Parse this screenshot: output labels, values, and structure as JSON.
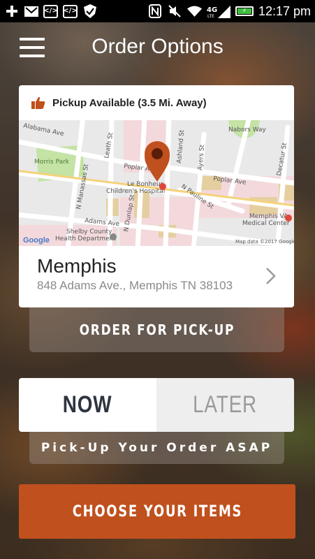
{
  "status_bar": {
    "icons": [
      "plus-icon",
      "gmail-icon",
      "code-icon",
      "code-icon",
      "check-shield-icon",
      "nfc-icon",
      "mute-icon",
      "wifi-icon",
      "lte-signal-icon",
      "battery-charging-icon"
    ],
    "network": "4G LTE",
    "time": "12:17 pm"
  },
  "header": {
    "title": "Order Options"
  },
  "location_card": {
    "pickup_label": "Pickup Available (3.5 Mi. Away)",
    "map": {
      "labels": {
        "alabama": "Alabama Ave",
        "morris_park": "Morris Park",
        "leath": "Leath St",
        "nabors": "Nabors Way",
        "ashland": "Ashland St",
        "ayers": "Ayers St",
        "decatur": "Decatur St",
        "poplar_left": "Poplar Ave",
        "poplar_right": "Poplar Ave",
        "le_bonheur_1": "Le Bonheur",
        "le_bonheur_2": "Children's Hospital",
        "manassas": "N Manassas St",
        "pauline": "N Pauline St",
        "dunlap": "N Dunlap St",
        "adams": "Adams Ave",
        "va_1": "Memphis VA",
        "va_2": "Medical Center",
        "shelby_1": "Shelby County",
        "shelby_2": "Health Department",
        "google": "Google",
        "map_data": "Map data ©2017 Google"
      }
    },
    "name": "Memphis",
    "address": "848 Adams Ave., Memphis TN 38103"
  },
  "order_type_label": "ORDER FOR PICK-UP",
  "timing": {
    "now_label": "NOW",
    "later_label": "LATER",
    "selected": "NOW"
  },
  "asap_label": "Pick-Up Your Order ASAP",
  "cta_label": "CHOOSE YOUR ITEMS",
  "colors": {
    "accent": "#c0501e",
    "map_pin": "#c0501e",
    "battery": "#3fbf3f"
  }
}
